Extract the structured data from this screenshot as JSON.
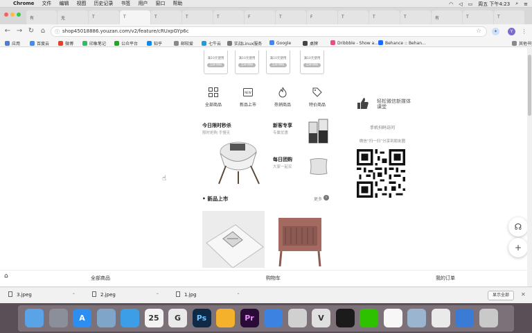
{
  "menubar": {
    "items": [
      "Chrome",
      "文件",
      "编辑",
      "视图",
      "历史记录",
      "书签",
      "用户",
      "窗口",
      "帮助"
    ],
    "clock": "周五 下午4:23"
  },
  "tabs": [
    "有",
    "无",
    "T",
    "T",
    "T",
    "T",
    "T",
    "F",
    "T",
    "F",
    "T",
    "T",
    "T",
    "有",
    "T",
    "T"
  ],
  "avatar_letter": "Y",
  "address": {
    "url": "shop45018886.youzan.com/v2/feature/cRUxpGYp6c"
  },
  "bookmarks": [
    {
      "label": "应用",
      "color": "#4a7de0"
    },
    {
      "label": "百度云",
      "color": "#3a8bff"
    },
    {
      "label": "微博",
      "color": "#e6402b"
    },
    {
      "label": "印象笔记",
      "color": "#2dbe60"
    },
    {
      "label": "公众平台",
      "color": "#1aad19"
    },
    {
      "label": "知乎",
      "color": "#0f88eb"
    },
    {
      "label": "邮较爱",
      "color": "#888888"
    },
    {
      "label": "七牛云",
      "color": "#19a0e4"
    },
    {
      "label": "实战Linux服务",
      "color": "#777777"
    },
    {
      "label": "Google",
      "color": "#4285f4"
    },
    {
      "label": "桌牌",
      "color": "#444444"
    },
    {
      "label": "Dribbble - Show a...",
      "color": "#ea4c89"
    },
    {
      "label": "Behance :: Behan...",
      "color": "#1769ff"
    },
    {
      "label": "其他书签",
      "color": "#888888"
    }
  ],
  "store": {
    "coupons": [
      {
        "text": "满10元使用",
        "button": "立即领取"
      },
      {
        "text": "满10元使用",
        "button": "立即领取"
      },
      {
        "text": "满10元使用",
        "button": "立即领取"
      },
      {
        "text": "满10元使用",
        "button": "立即领取"
      }
    ],
    "categories": [
      "全部商品",
      "新品上市",
      "热销商品",
      "特价商品"
    ],
    "promos": {
      "flash": {
        "title": "今日限时秒杀",
        "subtitle": "限时抢购 手慢无"
      },
      "new_user": {
        "title": "新客专享",
        "subtitle": "专属优惠"
      },
      "group": {
        "title": "每日团购",
        "subtitle": "大家一起买"
      }
    },
    "section": {
      "title": "• 新品上市",
      "more": "更多"
    },
    "bottom_nav": [
      "全部商品",
      "购物车",
      "我的订单"
    ]
  },
  "side_panel": {
    "thumb_label": "轻松微信新媒体课堂",
    "qr_title": "手机扫码访问",
    "qr_hint": "微信“扫一扫”分享到朋友圈"
  },
  "downloads": {
    "files": [
      "3.jpeg",
      "2.jpeg",
      "1.jpg"
    ],
    "show_all": "显示全部"
  },
  "dock": {
    "apps": [
      {
        "name": "finder",
        "label": "",
        "color": "#5aa3e6"
      },
      {
        "name": "launchpad",
        "label": "",
        "color": "#8a8f9a"
      },
      {
        "name": "app-store",
        "label": "A",
        "color": "#2c8ef0"
      },
      {
        "name": "preview",
        "label": "",
        "color": "#7fa6c9"
      },
      {
        "name": "safari",
        "label": "",
        "color": "#3d9ee8"
      },
      {
        "name": "calendar",
        "label": "25",
        "color": "#f3f3f3"
      },
      {
        "name": "google-chrome",
        "label": "G",
        "color": "#e9e9e9"
      },
      {
        "name": "photoshop",
        "label": "Ps",
        "color": "#0e2a47"
      },
      {
        "name": "sketch",
        "label": "",
        "color": "#f3b12c"
      },
      {
        "name": "premiere",
        "label": "Pr",
        "color": "#2a0a37"
      },
      {
        "name": "keynote",
        "label": "",
        "color": "#3c82e0"
      },
      {
        "name": "sketchbook",
        "label": "",
        "color": "#d0d0d0"
      },
      {
        "name": "vectornator",
        "label": "V",
        "color": "#e0e0e0"
      },
      {
        "name": "qq",
        "label": "",
        "color": "#1b1b1b"
      },
      {
        "name": "wechat",
        "label": "",
        "color": "#2dc100"
      },
      {
        "name": "notes",
        "label": "",
        "color": "#f7f7f7"
      },
      {
        "name": "finder-window",
        "label": "",
        "color": "#9ab5cf"
      },
      {
        "name": "photos",
        "label": "",
        "color": "#eaeaea"
      },
      {
        "name": "downloads-stack",
        "label": "",
        "color": "#3a7bd5"
      },
      {
        "name": "trash",
        "label": "",
        "color": "#c9c9c9"
      }
    ]
  }
}
